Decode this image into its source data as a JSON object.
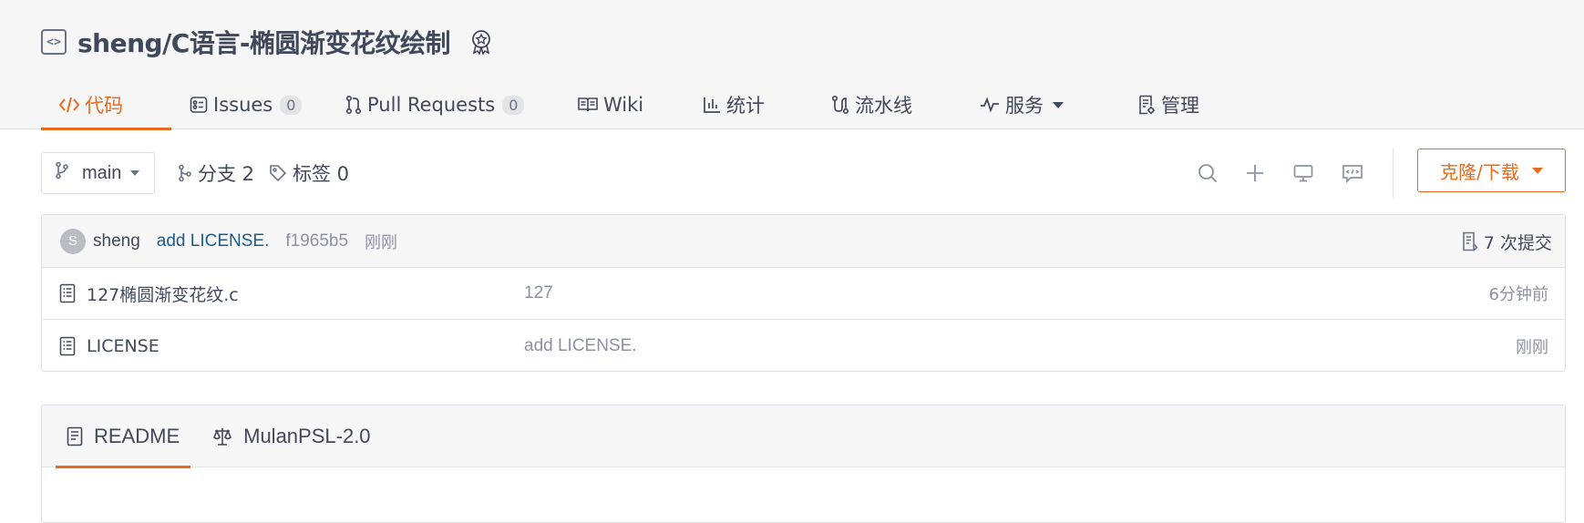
{
  "repo": {
    "name": "sheng/C语言-椭圆渐变花纹绘制"
  },
  "tabs": [
    {
      "label": "代码",
      "active": true
    },
    {
      "label": "Issues",
      "count": "0"
    },
    {
      "label": "Pull Requests",
      "count": "0"
    },
    {
      "label": "Wiki"
    },
    {
      "label": "统计"
    },
    {
      "label": "流水线"
    },
    {
      "label": "服务"
    },
    {
      "label": "管理"
    }
  ],
  "toolbar": {
    "branch": "main",
    "branches_label": "分支 2",
    "tags_label": "标签 0",
    "clone_label": "克隆/下载"
  },
  "last_commit": {
    "avatar_letter": "S",
    "author": "sheng",
    "message": "add LICENSE.",
    "sha": "f1965b5",
    "time": "刚刚",
    "commit_count_label": "7 次提交"
  },
  "files": [
    {
      "name": "127椭圆渐变花纹.c",
      "message": "127",
      "time": "6分钟前"
    },
    {
      "name": "LICENSE",
      "message": "add LICENSE.",
      "time": "刚刚"
    }
  ],
  "readme_tabs": [
    {
      "label": "README",
      "active": true
    },
    {
      "label": "MulanPSL-2.0"
    }
  ],
  "colors": {
    "accent": "#e86c1e",
    "link": "#1e5b8a",
    "muted": "#8c92a4"
  }
}
